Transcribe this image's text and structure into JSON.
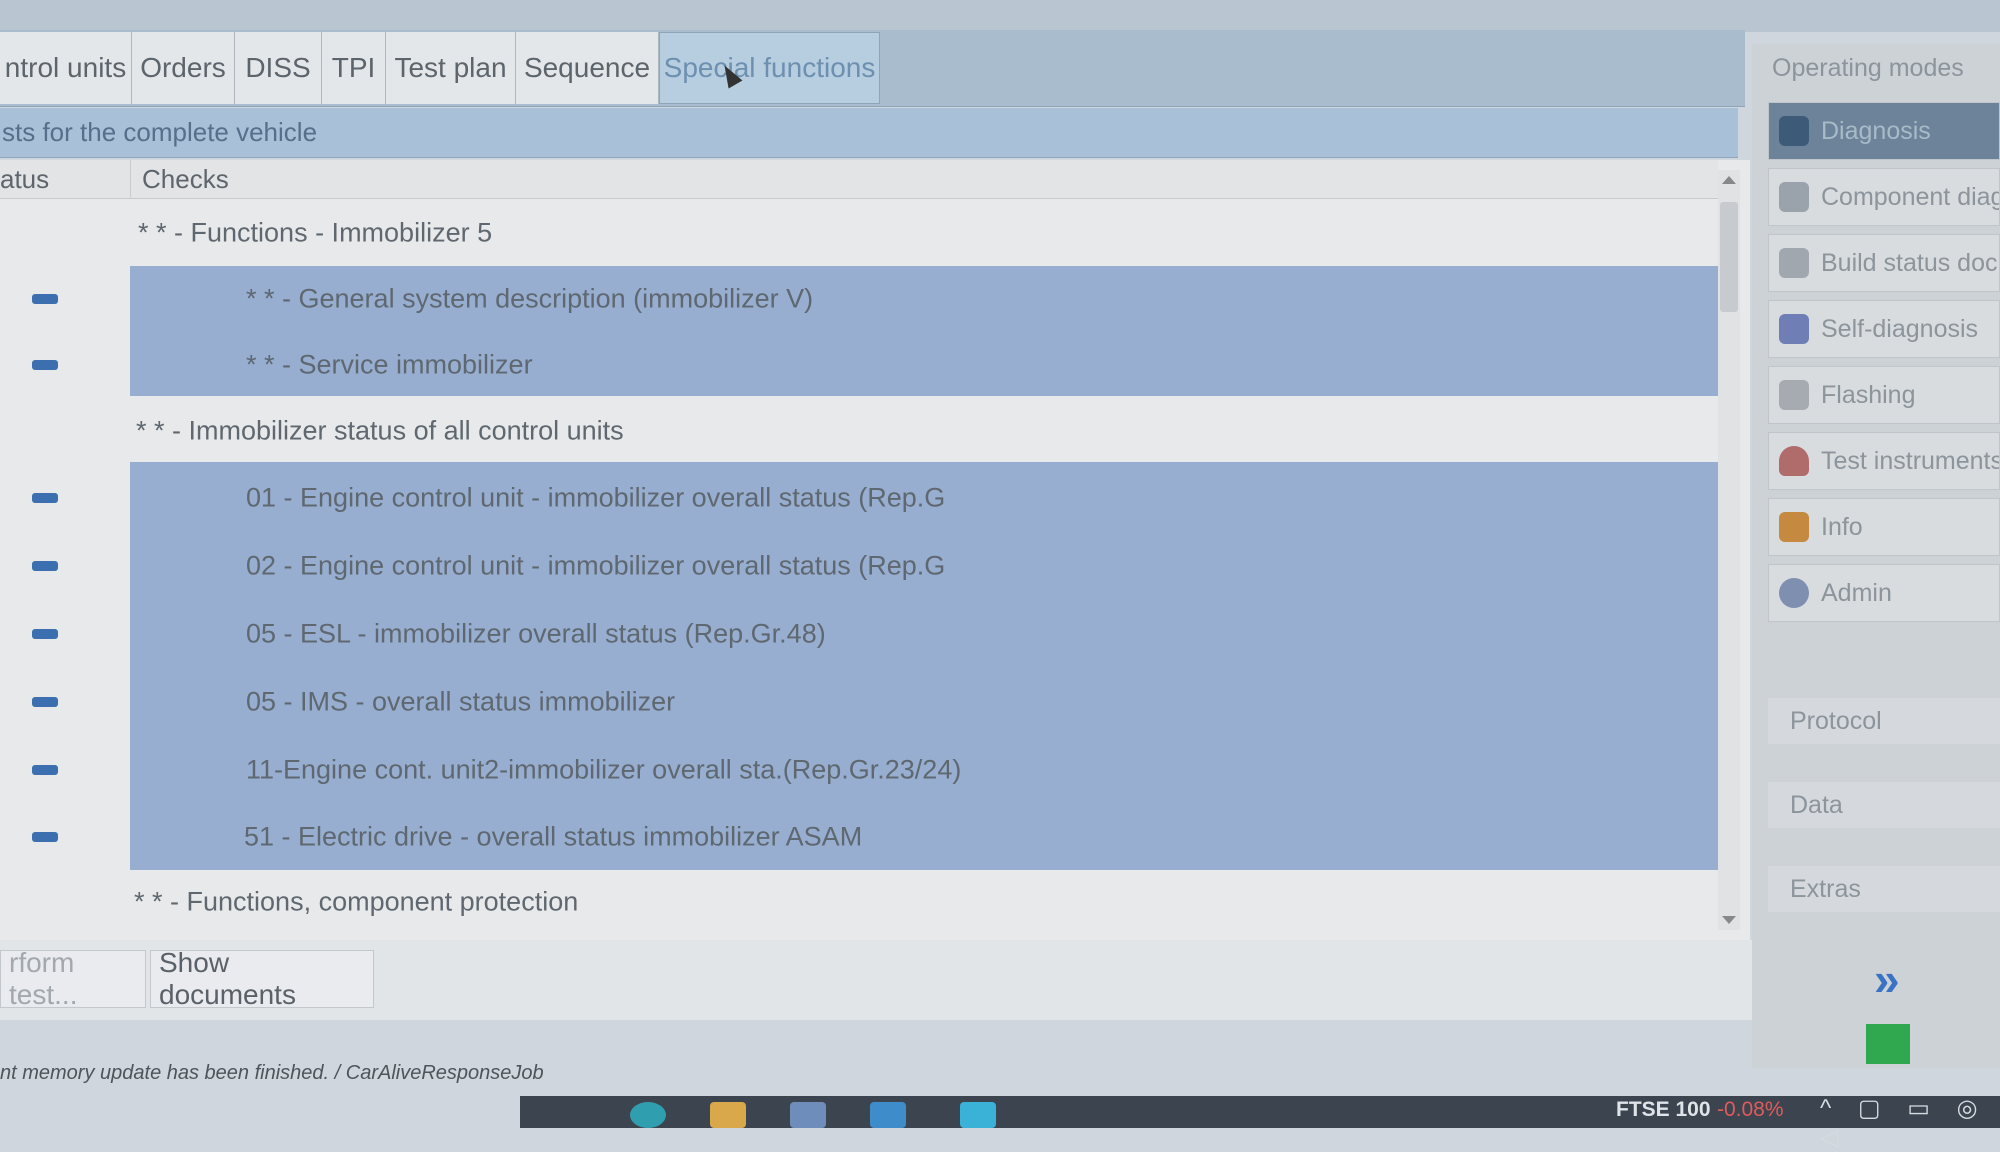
{
  "tabs": [
    "ntrol units",
    "Orders",
    "DISS",
    "TPI",
    "Test plan",
    "Sequence",
    "Special functions"
  ],
  "section_title": "sts for the complete vehicle",
  "table": {
    "col_status": "atus",
    "col_checks": "Checks",
    "rows": [
      {
        "label": "* * - Functions - Immobilizer 5",
        "selected": false,
        "status": ""
      },
      {
        "label": "* * - General system description (immobilizer V)",
        "selected": true,
        "status": "dash"
      },
      {
        "label": "* * - Service immobilizer",
        "selected": true,
        "status": "dash"
      },
      {
        "label": "* * - Immobilizer status of all control units",
        "selected": false,
        "status": ""
      },
      {
        "label": "01 - Engine control unit - immobilizer overall status (Rep.G",
        "selected": true,
        "status": "dash"
      },
      {
        "label": "02 - Engine control unit - immobilizer overall status (Rep.G",
        "selected": true,
        "status": "dash"
      },
      {
        "label": "05 - ESL - immobilizer overall status (Rep.Gr.48)",
        "selected": true,
        "status": "dash"
      },
      {
        "label": "05 - IMS - overall status immobilizer",
        "selected": true,
        "status": "dash"
      },
      {
        "label": "11-Engine cont. unit2-immobilizer overall sta.(Rep.Gr.23/24)",
        "selected": true,
        "status": "dash"
      },
      {
        "label": "51 - Electric drive - overall status immobilizer ASAM",
        "selected": true,
        "status": "dash"
      },
      {
        "label": "* * - Functions, component protection",
        "selected": false,
        "status": ""
      }
    ]
  },
  "buttons": {
    "perform_test": "rform test...",
    "show_documents": "Show documents"
  },
  "status_message": "nt memory update has been finished. / CarAliveResponseJob",
  "right_panel": {
    "title": "Operating modes",
    "modes": [
      {
        "label": "Diagnosis",
        "icon": "stethoscope-icon",
        "active": true
      },
      {
        "label": "Component diagn",
        "icon": "component-icon",
        "active": false
      },
      {
        "label": "Build status docu",
        "icon": "document-icon",
        "active": false
      },
      {
        "label": "Self-diagnosis",
        "icon": "self-diagnosis-icon",
        "active": false
      },
      {
        "label": "Flashing",
        "icon": "flash-icon",
        "active": false
      },
      {
        "label": "Test instruments",
        "icon": "gauge-icon",
        "active": false
      },
      {
        "label": "Info",
        "icon": "info-icon",
        "active": false
      },
      {
        "label": "Admin",
        "icon": "admin-icon",
        "active": false
      }
    ],
    "sections": [
      "Protocol",
      "Data",
      "Extras"
    ]
  },
  "taskbar": {
    "ticker_name": "FTSE 100",
    "ticker_change": "-0.08%"
  },
  "colors": {
    "selection": "#97aed0",
    "status_dash": "#3b6fb0",
    "active_tab_text": "#6d8fb0",
    "ticker_negative": "#e05b5b"
  }
}
